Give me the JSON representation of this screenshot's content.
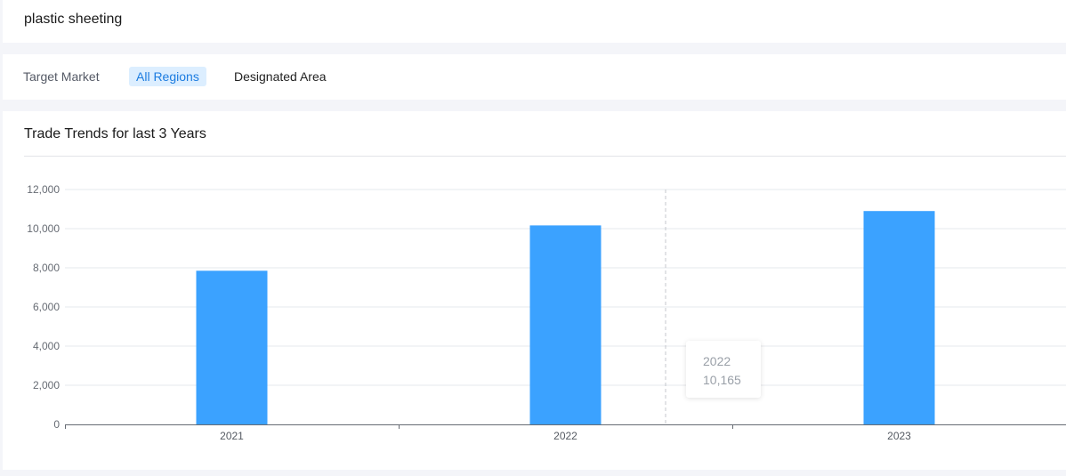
{
  "search": {
    "query": "plastic sheeting"
  },
  "filters": {
    "label": "Target Market",
    "options": [
      {
        "label": "All Regions",
        "active": true
      },
      {
        "label": "Designated Area",
        "active": false
      }
    ]
  },
  "colors": {
    "bar": "#3ba2ff",
    "accent": "#1c7ce0",
    "active_bg": "#dceeff"
  },
  "chart_data": {
    "type": "bar",
    "title": "Trade Trends for last 3 Years",
    "categories": [
      "2021",
      "2022",
      "2023"
    ],
    "values": [
      7850,
      10165,
      10900
    ],
    "ylim": [
      0,
      12000
    ],
    "yticks": [
      0,
      2000,
      4000,
      6000,
      8000,
      10000,
      12000
    ],
    "ytick_labels": [
      "0",
      "2,000",
      "4,000",
      "6,000",
      "8,000",
      "10,000",
      "12,000"
    ],
    "grid": true,
    "legend": "none",
    "tooltip": {
      "category": "2022",
      "value": "10,165"
    }
  }
}
